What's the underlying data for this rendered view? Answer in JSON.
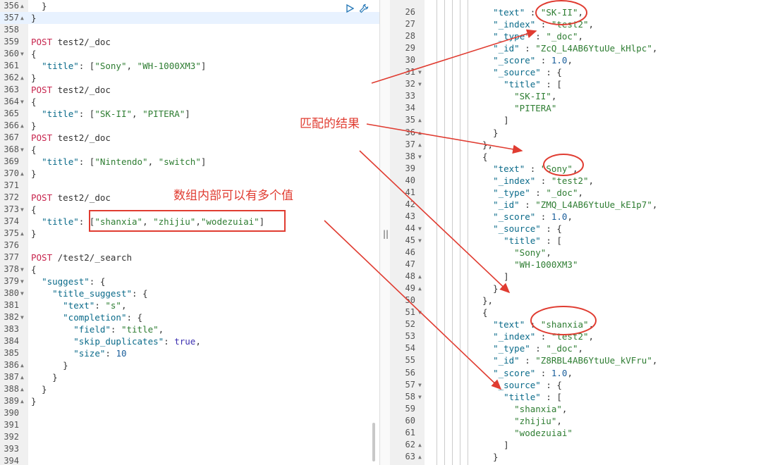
{
  "colors": {
    "annotation": "#e03c31",
    "keyword": "#c7254e",
    "string": "#2e7d32",
    "key": "#0b6b8a"
  },
  "left_editor": {
    "lines": [
      {
        "n": "356",
        "fold": "▲",
        "t": "  }"
      },
      {
        "n": "357",
        "fold": "▲",
        "t": "}"
      },
      {
        "n": "358",
        "fold": "",
        "t": ""
      },
      {
        "n": "359",
        "fold": "",
        "t": "POST test2/_doc"
      },
      {
        "n": "360",
        "fold": "▼",
        "t": "{"
      },
      {
        "n": "361",
        "fold": "",
        "t": "  \"title\": [\"Sony\", \"WH-1000XM3\"]"
      },
      {
        "n": "362",
        "fold": "▲",
        "t": "}"
      },
      {
        "n": "363",
        "fold": "",
        "t": "POST test2/_doc"
      },
      {
        "n": "364",
        "fold": "▼",
        "t": "{"
      },
      {
        "n": "365",
        "fold": "",
        "t": "  \"title\": [\"SK-II\", \"PITERA\"]"
      },
      {
        "n": "366",
        "fold": "▲",
        "t": "}"
      },
      {
        "n": "367",
        "fold": "",
        "t": "POST test2/_doc"
      },
      {
        "n": "368",
        "fold": "▼",
        "t": "{"
      },
      {
        "n": "369",
        "fold": "",
        "t": "  \"title\": [\"Nintendo\", \"switch\"]"
      },
      {
        "n": "370",
        "fold": "▲",
        "t": "}"
      },
      {
        "n": "371",
        "fold": "",
        "t": ""
      },
      {
        "n": "372",
        "fold": "",
        "t": "POST test2/_doc"
      },
      {
        "n": "373",
        "fold": "▼",
        "t": "{"
      },
      {
        "n": "374",
        "fold": "",
        "t": "  \"title\": [\"shanxia\", \"zhijiu\",\"wodezuiai\"]"
      },
      {
        "n": "375",
        "fold": "▲",
        "t": "}"
      },
      {
        "n": "376",
        "fold": "",
        "t": ""
      },
      {
        "n": "377",
        "fold": "",
        "t": "POST /test2/_search"
      },
      {
        "n": "378",
        "fold": "▼",
        "t": "{"
      },
      {
        "n": "379",
        "fold": "▼",
        "t": "  \"suggest\": {"
      },
      {
        "n": "380",
        "fold": "▼",
        "t": "    \"title_suggest\": {"
      },
      {
        "n": "381",
        "fold": "",
        "t": "      \"text\": \"s\","
      },
      {
        "n": "382",
        "fold": "▼",
        "t": "      \"completion\": {"
      },
      {
        "n": "383",
        "fold": "",
        "t": "        \"field\": \"title\","
      },
      {
        "n": "384",
        "fold": "",
        "t": "        \"skip_duplicates\": true,"
      },
      {
        "n": "385",
        "fold": "",
        "t": "        \"size\": 10"
      },
      {
        "n": "386",
        "fold": "▲",
        "t": "      }"
      },
      {
        "n": "387",
        "fold": "▲",
        "t": "    }"
      },
      {
        "n": "388",
        "fold": "▲",
        "t": "  }"
      },
      {
        "n": "389",
        "fold": "▲",
        "t": "}"
      },
      {
        "n": "390",
        "fold": "",
        "t": ""
      },
      {
        "n": "391",
        "fold": "",
        "t": ""
      },
      {
        "n": "392",
        "fold": "",
        "t": ""
      },
      {
        "n": "393",
        "fold": "",
        "t": ""
      },
      {
        "n": "394",
        "fold": "",
        "t": ""
      }
    ]
  },
  "right_editor": {
    "lines": [
      {
        "n": "26",
        "fold": "",
        "t": "  \"text\" : \"SK-II\","
      },
      {
        "n": "27",
        "fold": "",
        "t": "  \"_index\" : \"test2\","
      },
      {
        "n": "28",
        "fold": "",
        "t": "  \"_type\" : \"_doc\","
      },
      {
        "n": "29",
        "fold": "",
        "t": "  \"_id\" : \"ZcQ_L4AB6YtuUe_kHlpc\","
      },
      {
        "n": "30",
        "fold": "",
        "t": "  \"_score\" : 1.0,"
      },
      {
        "n": "31",
        "fold": "▼",
        "t": "  \"_source\" : {"
      },
      {
        "n": "32",
        "fold": "▼",
        "t": "    \"title\" : ["
      },
      {
        "n": "33",
        "fold": "",
        "t": "      \"SK-II\","
      },
      {
        "n": "34",
        "fold": "",
        "t": "      \"PITERA\""
      },
      {
        "n": "35",
        "fold": "▲",
        "t": "    ]"
      },
      {
        "n": "36",
        "fold": "▲",
        "t": "  }"
      },
      {
        "n": "37",
        "fold": "▲",
        "t": "},"
      },
      {
        "n": "38",
        "fold": "▼",
        "t": "{"
      },
      {
        "n": "39",
        "fold": "",
        "t": "  \"text\" : \"Sony\","
      },
      {
        "n": "40",
        "fold": "",
        "t": "  \"_index\" : \"test2\","
      },
      {
        "n": "41",
        "fold": "",
        "t": "  \"_type\" : \"_doc\","
      },
      {
        "n": "42",
        "fold": "",
        "t": "  \"_id\" : \"ZMQ_L4AB6YtuUe_kE1p7\","
      },
      {
        "n": "43",
        "fold": "",
        "t": "  \"_score\" : 1.0,"
      },
      {
        "n": "44",
        "fold": "▼",
        "t": "  \"_source\" : {"
      },
      {
        "n": "45",
        "fold": "▼",
        "t": "    \"title\" : ["
      },
      {
        "n": "46",
        "fold": "",
        "t": "      \"Sony\","
      },
      {
        "n": "47",
        "fold": "",
        "t": "      \"WH-1000XM3\""
      },
      {
        "n": "48",
        "fold": "▲",
        "t": "    ]"
      },
      {
        "n": "49",
        "fold": "▲",
        "t": "  }"
      },
      {
        "n": "50",
        "fold": "",
        "t": "},"
      },
      {
        "n": "51",
        "fold": "▼",
        "t": "{"
      },
      {
        "n": "52",
        "fold": "",
        "t": "  \"text\" : \"shanxia\","
      },
      {
        "n": "53",
        "fold": "",
        "t": "  \"_index\" : \"test2\","
      },
      {
        "n": "54",
        "fold": "",
        "t": "  \"_type\" : \"_doc\","
      },
      {
        "n": "55",
        "fold": "",
        "t": "  \"_id\" : \"Z8RBL4AB6YtuUe_kVFru\","
      },
      {
        "n": "56",
        "fold": "",
        "t": "  \"_score\" : 1.0,"
      },
      {
        "n": "57",
        "fold": "▼",
        "t": "  \"_source\" : {"
      },
      {
        "n": "58",
        "fold": "▼",
        "t": "    \"title\" : ["
      },
      {
        "n": "59",
        "fold": "",
        "t": "      \"shanxia\","
      },
      {
        "n": "60",
        "fold": "",
        "t": "      \"zhijiu\","
      },
      {
        "n": "61",
        "fold": "",
        "t": "      \"wodezuiai\""
      },
      {
        "n": "62",
        "fold": "▲",
        "t": "    ]"
      },
      {
        "n": "63",
        "fold": "▲",
        "t": "  }"
      }
    ]
  },
  "annotations": {
    "match_result": "匹配的结果",
    "array_multi_value": "数组内部可以有多个值"
  },
  "toolbar": {
    "run_icon": "play-icon",
    "settings_icon": "wrench-icon"
  },
  "divider_grip": "||"
}
